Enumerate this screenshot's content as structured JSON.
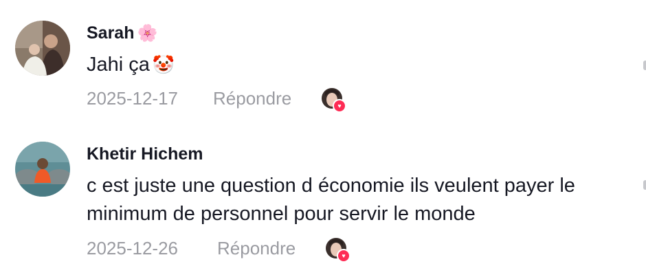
{
  "comments": [
    {
      "username": "Sarah",
      "username_emoji": "🌸",
      "text": "Jahi ça",
      "text_emoji": "🤡",
      "date": "2025-12-17",
      "reply_label": "Répondre"
    },
    {
      "username": "Khetir Hichem",
      "text": "c est juste une question d économie ils veulent payer le minimum de personnel pour servir le monde",
      "date": "2025-12-26",
      "reply_label": "Répondre"
    }
  ],
  "colors": {
    "text_primary": "#161823",
    "text_secondary": "#9a9ba1",
    "like_badge": "#fe2c55"
  },
  "icons": {
    "liked_by_creator": "heart-icon"
  }
}
